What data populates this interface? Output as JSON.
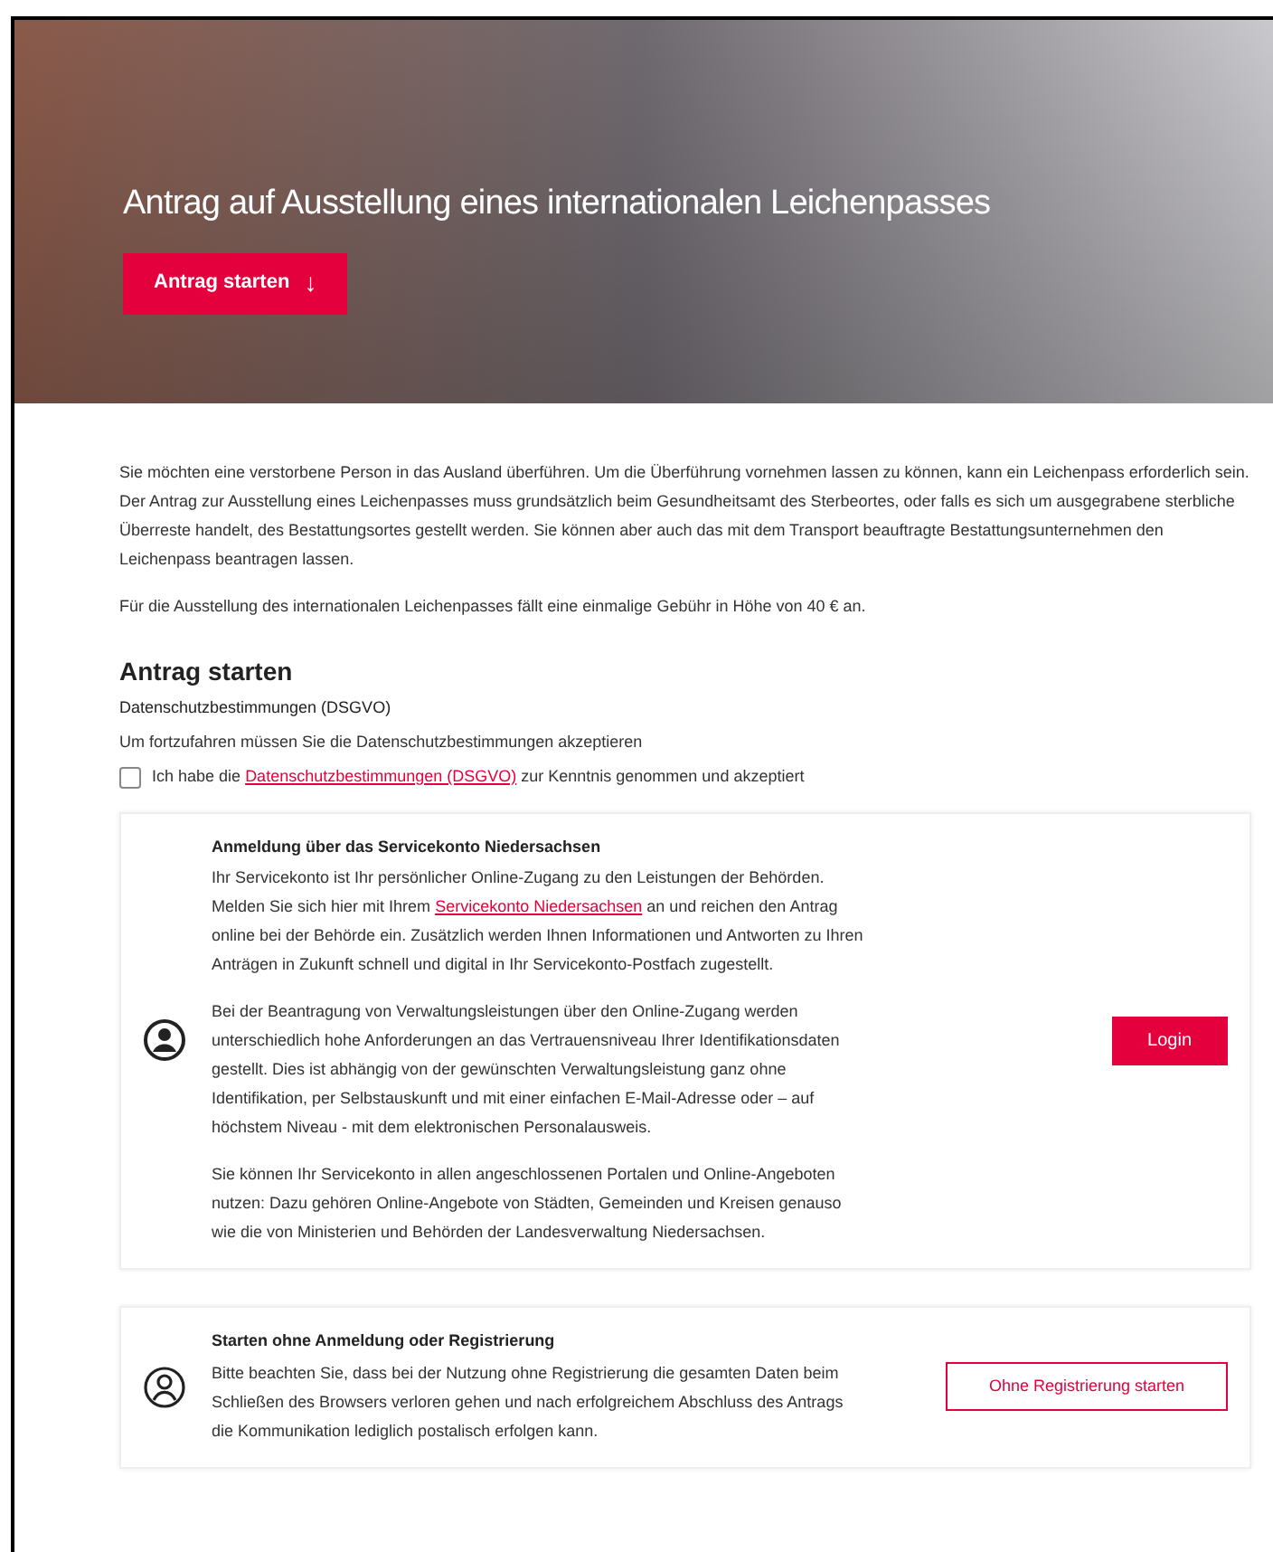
{
  "hero": {
    "title": "Antrag auf Ausstellung eines internationalen Leichenpasses",
    "button": {
      "label": "Antrag starten",
      "icon": "↓"
    }
  },
  "intro": [
    "Sie möchten eine verstorbene Person in das Ausland überführen. Um die Überführung vornehmen lassen zu können, kann ein Leichenpass erforderlich sein. Der Antrag zur Ausstellung eines Leichenpasses muss grundsätzlich beim Gesundheitsamt des Sterbeortes, oder falls es sich um ausgegrabene sterbliche Überreste handelt, des Bestattungsortes gestellt werden. Sie können aber auch das mit dem Transport beauftragte Bestattungsunternehmen den Leichenpass beantragen lassen.",
    "Für die Ausstellung des internationalen Leichenpasses fällt eine einmalige Gebühr in Höhe von 40 € an."
  ],
  "section": {
    "heading": "Antrag starten",
    "subheading": "Datenschutzbestimmungen (DSGVO)",
    "note": "Um fortzufahren müssen Sie die Datenschutzbestimmungen akzeptieren",
    "consent": {
      "checked": false,
      "before": "Ich habe die",
      "link": "Datenschutzbestimmungen (DSGVO)",
      "after": "zur Kenntnis genommen und akzeptiert"
    }
  },
  "cards": [
    {
      "kind": "login",
      "title": "Anmeldung über das Servicekonto Niedersachsen",
      "paragraphs": [
        {
          "before": "Ihr Servicekonto ist Ihr persönlicher Online-Zugang zu den Leistungen der Behörden. Melden Sie sich hier mit Ihrem",
          "link": "Servicekonto Niedersachsen",
          "after": "an und reichen den Antrag online bei der Behörde ein. Zusätzlich werden Ihnen Informationen und Antworten zu Ihren Anträgen in Zukunft schnell und digital in Ihr Servicekonto-Postfach zugestellt."
        },
        {
          "before": "Bei der Beantragung von Verwaltungsleistungen über den Online-Zugang werden unterschiedlich hohe Anforderungen an das Vertrauensniveau Ihrer Identifikationsdaten gestellt. Dies ist abhängig von der gewünschten Verwaltungsleistung ganz ohne Identifikation, per Selbstauskunft und mit einer einfachen E-Mail-Adresse oder – auf höchstem Niveau - mit dem elektronischen Personalausweis."
        },
        {
          "before": "Sie können Ihr Servicekonto in allen angeschlossenen Portalen und Online-Angeboten nutzen: Dazu gehören Online-Angebote von Städten, Gemeinden und Kreisen genauso wie die von Ministerien und Behörden der Landesverwaltung Niedersachsen."
        }
      ],
      "button": "Login"
    },
    {
      "kind": "guest",
      "title": "Starten ohne Anmeldung oder Registrierung",
      "paragraphs": [
        {
          "before": "Bitte beachten Sie, dass bei der Nutzung ohne Registrierung die gesamten Daten beim Schließen des Browsers verloren gehen und nach erfolgreichem Abschluss des Antrags die Kommunikation lediglich postalisch erfolgen kann."
        }
      ],
      "button": "Ohne Registrierung starten"
    }
  ]
}
